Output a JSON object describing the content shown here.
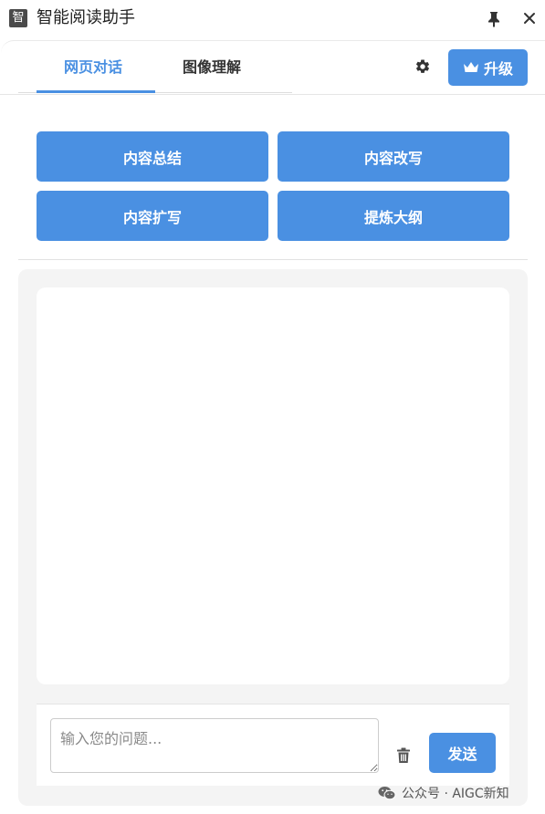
{
  "window": {
    "icon_char": "智",
    "title": "智能阅读助手",
    "pin_icon": "pin-icon",
    "close_icon": "close-icon"
  },
  "tabs": [
    {
      "label": "网页对话",
      "active": true
    },
    {
      "label": "图像理解",
      "active": false
    }
  ],
  "header": {
    "settings_icon": "gear-icon",
    "upgrade_icon": "crown-icon",
    "upgrade_label": "升级"
  },
  "actions": {
    "summary": "内容总结",
    "rewrite": "内容改写",
    "expand": "内容扩写",
    "outline": "提炼大纲"
  },
  "chat": {
    "placeholder": "输入您的问题...",
    "input_value": "",
    "clear_icon": "trash-icon",
    "send_label": "发送"
  },
  "watermark": {
    "icon": "wechat-icon",
    "text": "公众号 · AIGC新知"
  },
  "colors": {
    "accent": "#4a90e2",
    "panel_bg": "#f4f4f4",
    "text": "#222222"
  }
}
